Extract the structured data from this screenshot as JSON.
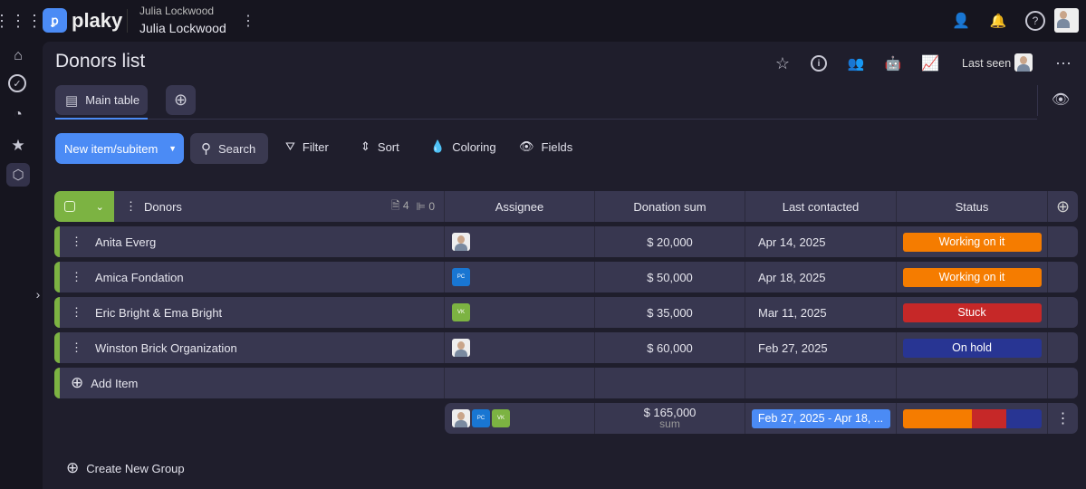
{
  "app": {
    "logo": "plaky",
    "workspace_small": "Julia Lockwood",
    "workspace": "Julia Lockwood"
  },
  "board": {
    "title": "Donors list",
    "last_seen": "Last seen",
    "view_tab": "Main table"
  },
  "toolbar": {
    "new_item": "New item/subitem",
    "search": "Search",
    "filter": "Filter",
    "sort": "Sort",
    "coloring": "Coloring",
    "fields": "Fields"
  },
  "group": {
    "name": "Donors",
    "items_count": "4",
    "subitems_count": "0",
    "color": "#7cb342"
  },
  "columns": [
    "Assignee",
    "Donation sum",
    "Last contacted",
    "Status"
  ],
  "rows": [
    {
      "name": "Anita Everg",
      "assignee": "face",
      "donation": "$ 20,000",
      "last": "Apr 14, 2025",
      "status": "Working on it",
      "status_color": "#f57c00"
    },
    {
      "name": "Amica Fondation",
      "assignee": "PC",
      "donation": "$ 50,000",
      "last": "Apr 18, 2025",
      "status": "Working on it",
      "status_color": "#f57c00"
    },
    {
      "name": "Eric Bright & Ema Bright",
      "assignee": "VK",
      "donation": "$ 35,000",
      "last": "Mar 11, 2025",
      "status": "Stuck",
      "status_color": "#c62828"
    },
    {
      "name": "Winston Brick Organization",
      "assignee": "face",
      "donation": "$ 60,000",
      "last": "Feb 27, 2025",
      "status": "On hold",
      "status_color": "#283593"
    }
  ],
  "add_item": "Add Item",
  "summary": {
    "pc": "PC",
    "vk": "VK",
    "sum": "$ 165,000",
    "sum_label": "sum",
    "date_range": "Feb 27, 2025 - Apr 18, ...",
    "status_distribution": [
      {
        "color": "#f57c00",
        "fraction": 0.5
      },
      {
        "color": "#c62828",
        "fraction": 0.25
      },
      {
        "color": "#283593",
        "fraction": 0.25
      }
    ]
  },
  "create_group": "Create New Group"
}
